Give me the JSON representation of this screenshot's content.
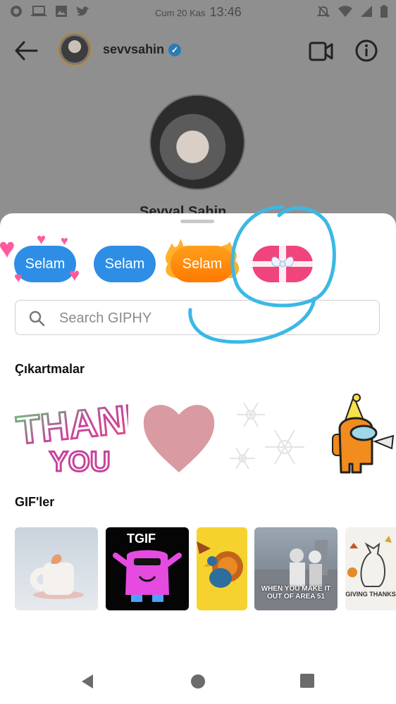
{
  "status_bar": {
    "date": "Cum 20 Kas",
    "time": "13:46",
    "left_icons": [
      "whatsapp-icon",
      "laptop-icon",
      "image-icon",
      "twitter-icon"
    ],
    "right_icons": [
      "alarm-off-icon",
      "wifi-icon",
      "signal-icon",
      "battery-icon"
    ]
  },
  "header": {
    "username": "sevvsahin",
    "verified": true
  },
  "profile": {
    "name": "Şevval Şahin"
  },
  "stickers_row": [
    {
      "label": "Selam",
      "style": "hearts",
      "color": "#2e8ee6"
    },
    {
      "label": "Selam",
      "style": "plain",
      "color": "#2e8ee6"
    },
    {
      "label": "Selam",
      "style": "fire",
      "color": "#ff8a00"
    },
    {
      "label": "",
      "style": "gift",
      "color": "#f0457c"
    }
  ],
  "search": {
    "placeholder": "Search GIPHY",
    "value": ""
  },
  "stickers_section": {
    "title": "Çıkartmalar",
    "items": [
      {
        "name": "thank-you-sticker",
        "text_top": "THANK",
        "text_bottom": "YOU"
      },
      {
        "name": "heart-sticker",
        "color": "#d99aa1"
      },
      {
        "name": "snowflakes-sticker"
      },
      {
        "name": "among-us-party-sticker"
      }
    ]
  },
  "gifs_section": {
    "title": "GIF'ler",
    "items": [
      {
        "name": "mug-gif",
        "caption": ""
      },
      {
        "name": "tgif-gif",
        "caption": "TGIF"
      },
      {
        "name": "turkey-gif",
        "caption": ""
      },
      {
        "name": "area51-gif",
        "caption": "WHEN YOU MAKE IT OUT OF AREA 51"
      },
      {
        "name": "giving-thanks-gif",
        "caption": "GIVING THANKS"
      }
    ]
  },
  "colors": {
    "accent_blue": "#2e8ee6",
    "annotation_circle": "#3bb8e6"
  }
}
